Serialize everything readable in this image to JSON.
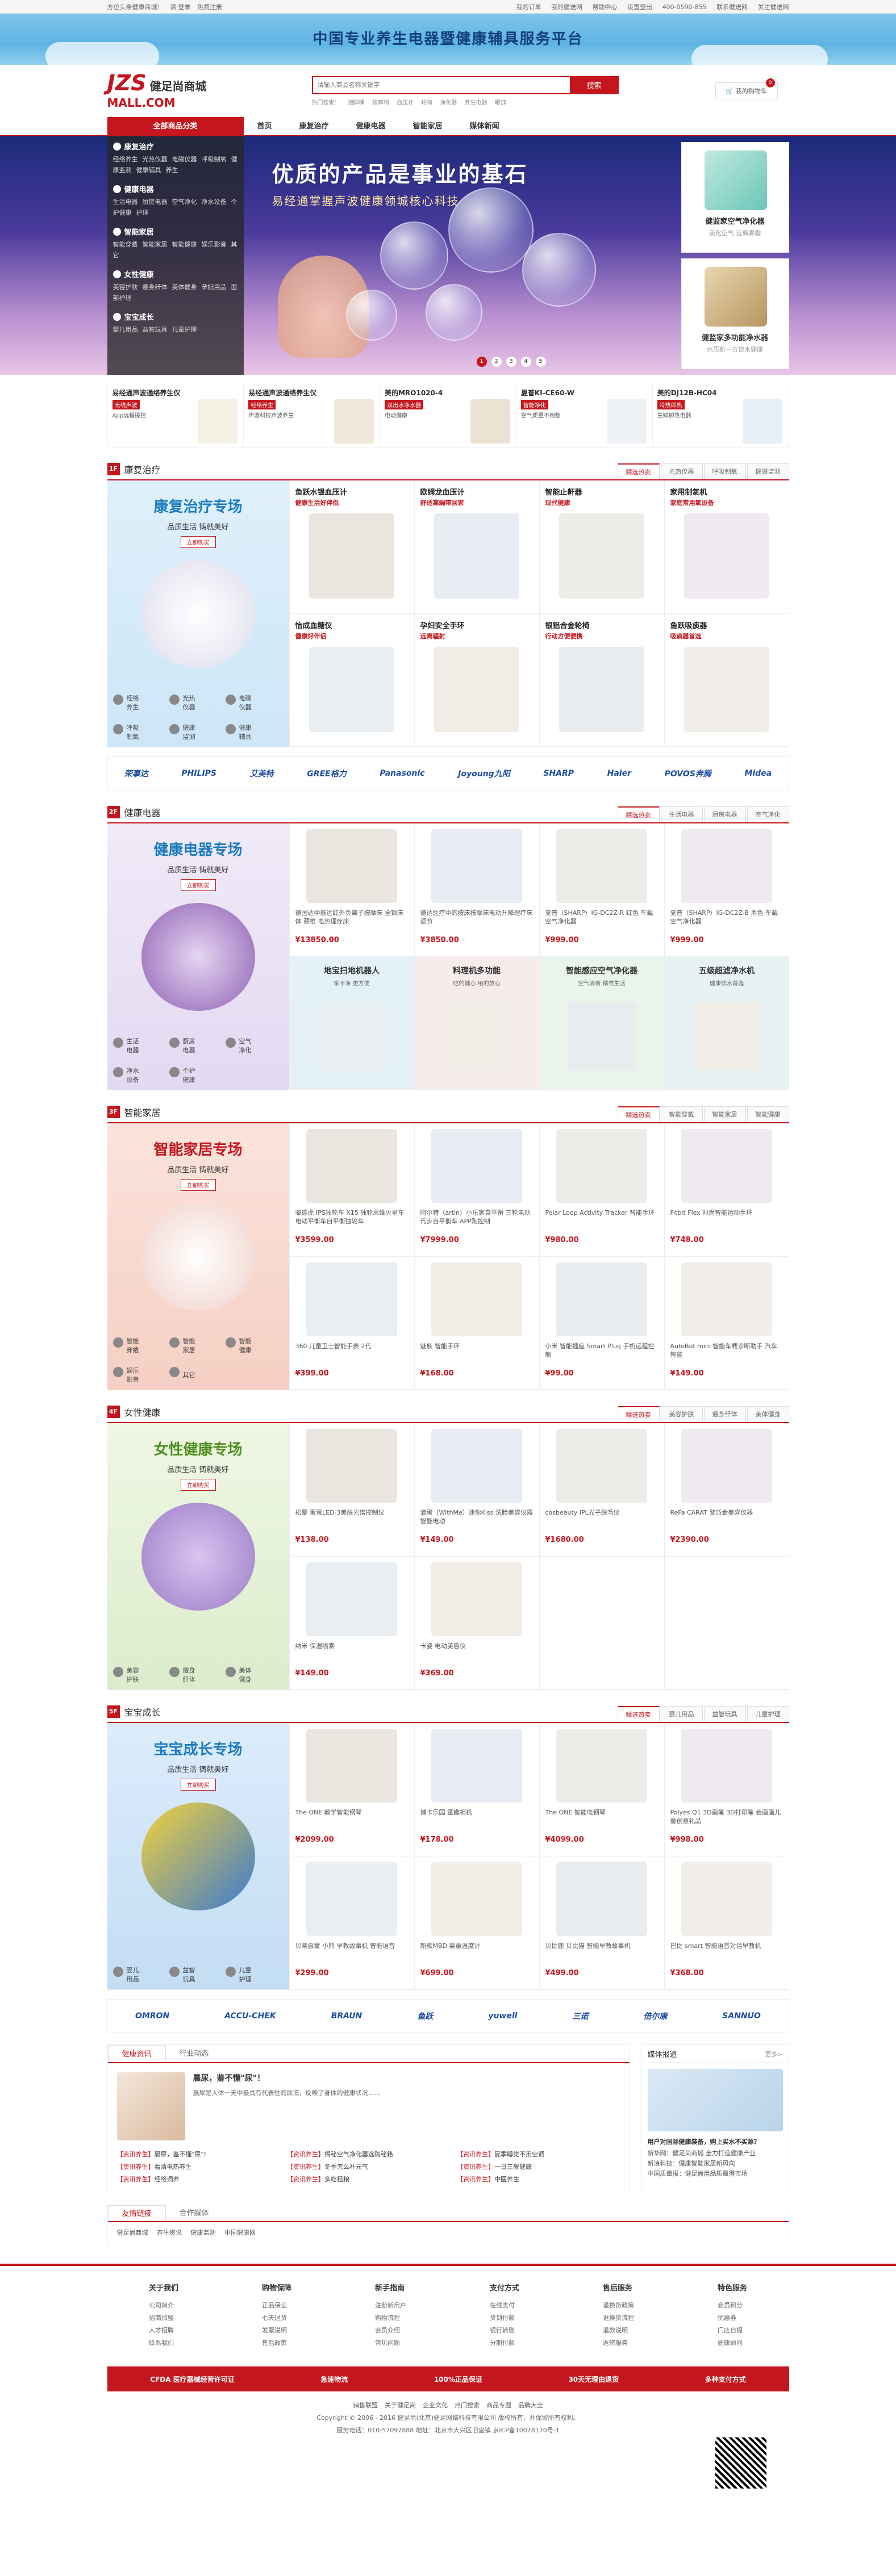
{
  "topbar": {
    "left": [
      "方位头条健康商城！",
      "请 登录",
      "免费注册"
    ],
    "right": [
      "我的订单",
      "我的健送网",
      "帮助中心",
      "设置登出",
      "400-0590-855",
      "联系健送网",
      "关注健送网"
    ]
  },
  "banner_strip": {
    "text": "中国专业养生电器暨健康辅具服务平台"
  },
  "logo": {
    "line1": "JZS",
    "line1b": "健足尚商城",
    "line2": "MALL.COM"
  },
  "search": {
    "placeholder": "请输入商品名称关键字",
    "button": "搜索",
    "hot": [
      "热门搜索：",
      "泡脚桶",
      "按摩椅",
      "血压计",
      "轮椅",
      "净化器",
      "养生电器",
      "眼部"
    ]
  },
  "cart": {
    "label": "我的购物车",
    "count": "0"
  },
  "nav": {
    "all": "全部商品分类",
    "items": [
      "首页",
      "康复治疗",
      "健康电器",
      "智能家居",
      "媒体新闻"
    ]
  },
  "categories": [
    {
      "title": "康复治疗",
      "subs": [
        "经络养生",
        "光热仪器",
        "电磁仪器",
        "呼吸制氧",
        "健康监测",
        "健康辅具",
        "养生"
      ]
    },
    {
      "title": "健康电器",
      "subs": [
        "生活电器",
        "厨房电器",
        "空气净化",
        "净水设备",
        "个护健康",
        "护理"
      ]
    },
    {
      "title": "智能家居",
      "subs": [
        "智能穿戴",
        "智能家居",
        "智能健康",
        "娱乐影音",
        "其它"
      ]
    },
    {
      "title": "女性健康",
      "subs": [
        "美容护肤",
        "瘦身纤体",
        "美体健身",
        "孕妇用品",
        "面部护理"
      ]
    },
    {
      "title": "宝宝成长",
      "subs": [
        "婴儿用品",
        "益智玩具",
        "儿童护理"
      ]
    }
  ],
  "hero": {
    "title": "优质的产品是事业的基石",
    "subtitle": "易经通掌握声波健康领城核心科技",
    "dots": [
      "1",
      "2",
      "3",
      "4",
      "5"
    ],
    "cards": [
      {
        "t1": "健监家空气净化器",
        "t2": "美化空气 远离雾霾"
      },
      {
        "t1": "健监家多功能净水器",
        "t2": "水质新一方饮水健康"
      }
    ]
  },
  "promos": [
    {
      "title": "易经通声波通络养生仪",
      "badge": "无线声波",
      "desc": "App远程操控"
    },
    {
      "title": "易经通声波通络养生仪",
      "badge": "经络养生",
      "desc": "声波科技声波养生"
    },
    {
      "title": "美的MRO1020-4",
      "badge": "双出水净水器",
      "desc": "电动健康"
    },
    {
      "title": "夏普KI-CE60-W",
      "badge": "智能净化",
      "desc": "空气质量不用愁"
    },
    {
      "title": "美的DJ12B-HC04",
      "badge": "冷热即热",
      "desc": "生鲜即热电器"
    }
  ],
  "sections": [
    {
      "icon": "1F",
      "title": "康复治疗",
      "tabs": [
        "精选热卖",
        "光热仪器",
        "呼吸制氧",
        "健康监测"
      ],
      "left": {
        "title": "康复治疗专场",
        "sub": "品质生活 铸就美好",
        "btn": "立即购买",
        "links": [
          "经络养生",
          "光热仪器",
          "电磁仪器",
          "呼吸制氧",
          "健康监测",
          "健康辅具"
        ]
      },
      "cells": [
        {
          "kind": "tag",
          "t": "鱼跃水银血压计",
          "d": "健康生活好伴侣"
        },
        {
          "kind": "tag",
          "t": "欧姆龙血压计",
          "d": "舒适高端带回家"
        },
        {
          "kind": "tag",
          "t": "智能止鼾器",
          "d": "现代健康"
        },
        {
          "kind": "tag",
          "t": "家用制氧机",
          "d": "家庭常用氧设备"
        },
        {
          "kind": "tag",
          "t": "怡成血糖仪",
          "d": "健康好伴侣"
        },
        {
          "kind": "tag",
          "t": "孕妇安全手环",
          "d": "远离辐射"
        },
        {
          "kind": "tag",
          "t": "银铝合金轮椅",
          "d": "行动方便便携"
        },
        {
          "kind": "tag",
          "t": "鱼跃吸痰器",
          "d": "吸痰器首选"
        }
      ]
    },
    {
      "icon": "2F",
      "title": "健康电器",
      "tabs": [
        "精选热卖",
        "生活电器",
        "厨房电器",
        "空气净化"
      ],
      "left": {
        "title": "健康电器专场",
        "sub": "品质生活 铸就美好",
        "btn": "立即购买",
        "links": [
          "生活电器",
          "厨房电器",
          "空气净化",
          "净水设备",
          "个护健康"
        ]
      },
      "cells": [
        {
          "kind": "prod",
          "n": "德国达中能远红外负离子按摩床 全钢床体 颈椎 电热理疗床",
          "p": "¥13850.00"
        },
        {
          "kind": "prod",
          "n": "德达医疗中的按床按摩床电动升降理疗床调节",
          "p": "¥3850.00"
        },
        {
          "kind": "prod",
          "n": "夏普（SHARP）IG-DC2Z-R 红色 车载空气净化器",
          "p": "¥999.00"
        },
        {
          "kind": "prod",
          "n": "夏普（SHARP）IG-DC2Z-B 黑色 车载空气净化器",
          "p": "¥999.00"
        },
        {
          "kind": "banner",
          "t": "地宝扫地机器人",
          "s": "家干净 更方便"
        },
        {
          "kind": "banner",
          "t": "料理机多功能",
          "s": "吃的健心 用的放心"
        },
        {
          "kind": "banner",
          "t": "智能感应空气净化器",
          "s": "空气清新 精致生活"
        },
        {
          "kind": "banner",
          "t": "五级超滤净水机",
          "s": "健康饮水首选"
        }
      ]
    },
    {
      "icon": "3F",
      "title": "智能家居",
      "tabs": [
        "精选热卖",
        "智能穿戴",
        "智能家居",
        "智能健康"
      ],
      "left": {
        "title": "智能家居专场",
        "sub": "品质生活 铸就美好",
        "btn": "立即购买",
        "links": [
          "智能穿戴",
          "智能家居",
          "智能健康",
          "娱乐影音",
          "其它"
        ]
      },
      "cells": [
        {
          "kind": "prod",
          "n": "骑德虎 IPS独轮车 X15 独轮思维火星车 电动平衡车自平衡独轮车",
          "p": "¥3599.00"
        },
        {
          "kind": "prod",
          "n": "阿尔特（artin）小乐家自平衡 三轮电动代步自平衡车 APP跑控制",
          "p": "¥7999.00"
        },
        {
          "kind": "prod",
          "n": "Polar Loop Activity Tracker 智能手环",
          "p": "¥980.00"
        },
        {
          "kind": "prod",
          "n": "Fitbit Flex 时尚智能运动手环",
          "p": "¥748.00"
        },
        {
          "kind": "prod",
          "n": "360 儿童卫士智能手表 2代",
          "p": "¥399.00"
        },
        {
          "kind": "prod",
          "n": "魅族 智能手环",
          "p": "¥168.00"
        },
        {
          "kind": "prod",
          "n": "小米 智能插座 Smart Plug 手机远程控制",
          "p": "¥99.00"
        },
        {
          "kind": "prod",
          "n": "AutoBot mini 智能车载诊断助手 汽车智能",
          "p": "¥149.00"
        }
      ]
    },
    {
      "icon": "4F",
      "title": "女性健康",
      "tabs": [
        "精选热卖",
        "美容护肤",
        "瘦身纤体",
        "美体健身"
      ],
      "left": {
        "title": "女性健康专场",
        "sub": "品质生活 铸就美好",
        "btn": "立即购买",
        "links": [
          "美容护肤",
          "瘦身纤体",
          "美体健身"
        ]
      },
      "cells": [
        {
          "kind": "prod",
          "n": "松厦 蛋蛋LED-3美肤光谱控制仪",
          "p": "¥138.00"
        },
        {
          "kind": "prod",
          "n": "滴蛋（WithMe）迷你Kiss 洗脸美容仪器 智能电动",
          "p": "¥149.00"
        },
        {
          "kind": "prod",
          "n": "cosbeauty IPL光子脱毛仪",
          "p": "¥1680.00"
        },
        {
          "kind": "prod",
          "n": "ReFa CARAT 黎派金美容仪器",
          "p": "¥2390.00"
        },
        {
          "kind": "prod",
          "n": "纳米 保湿喷雾",
          "p": "¥149.00"
        },
        {
          "kind": "prod",
          "n": "卡姿 电动美容仪",
          "p": "¥369.00"
        },
        {
          "kind": "empty"
        },
        {
          "kind": "empty"
        }
      ]
    },
    {
      "icon": "5F",
      "title": "宝宝成长",
      "tabs": [
        "精选热卖",
        "婴儿用品",
        "益智玩具",
        "儿童护理"
      ],
      "left": {
        "title": "宝宝成长专场",
        "sub": "品质生活 铸就美好",
        "btn": "立即购买",
        "links": [
          "婴儿用品",
          "益智玩具",
          "儿童护理"
        ]
      },
      "cells": [
        {
          "kind": "prod",
          "n": "The ONE 教学智能钢琴",
          "p": "¥2099.00"
        },
        {
          "kind": "prod",
          "n": "博卡乐园 童趣相机",
          "p": "¥178.00"
        },
        {
          "kind": "prod",
          "n": "The ONE 智能电钢琴",
          "p": "¥4099.00"
        },
        {
          "kind": "prod",
          "n": "Polyes Q1 3D画笔 3D打印笔 会画画儿童创意礼品",
          "p": "¥998.00"
        },
        {
          "kind": "prod",
          "n": "贝蒂启蒙 小熊 早教故事机 智能语音",
          "p": "¥299.00"
        },
        {
          "kind": "prod",
          "n": "新款MBD 婴童温度计",
          "p": "¥699.00"
        },
        {
          "kind": "prod",
          "n": "贝比鹿 贝比猫 智能早教故事机",
          "p": "¥499.00"
        },
        {
          "kind": "prod",
          "n": "巴比 smart 智能语音对话早教机",
          "p": "¥368.00"
        }
      ]
    }
  ],
  "brands1": [
    "荣事达",
    "PHILIPS",
    "艾美特",
    "GREE格力",
    "Panasonic",
    "Joyoung九阳",
    "SHARP",
    "Haier",
    "POVOS奔腾",
    "Midea"
  ],
  "brands2": [
    "OMRON",
    "ACCU-CHEK",
    "BRAUN",
    "鱼跃",
    "",
    "yuwell",
    "三诺",
    "倍尔康",
    "SANNUO"
  ],
  "news": {
    "tabs": [
      "健康资讯",
      "行业动态"
    ],
    "title": "晨尿，鉴不懂\"尿\"！",
    "text": "晨尿是人体一天中最具有代表性的尿液，反映了身体的健康状况……",
    "list": [
      [
        "【资讯养生】",
        "晨尿，鉴不懂\"尿\"!"
      ],
      [
        "【资讯养生】",
        "揭秘空气净化器选购秘籍"
      ],
      [
        "【资讯养生】",
        "夏季睡觉不用空调"
      ],
      [
        "【资讯养生】",
        "看清电热养生"
      ],
      [
        "【资讯养生】",
        "冬季怎么补元气"
      ],
      [
        "【资讯养生】",
        "一日三餐健康"
      ],
      [
        "【资讯养生】",
        "经络调养"
      ],
      [
        "【资讯养生】",
        "多吃粗粮"
      ],
      [
        "【资讯养生】",
        "中医养生"
      ]
    ]
  },
  "media": {
    "title": "媒体报道",
    "more": "更多>",
    "head": "用户对国际健康装备，购上买水不买源？",
    "lines": [
      "新华网：健足尚商城 全力打造健康产业",
      "新浪科技：健康智能家居新风向",
      "中国质量报：健足尚用品质赢得市场"
    ]
  },
  "links": {
    "tabs": [
      "友情链接",
      "合作媒体"
    ],
    "items": [
      "健足尚商城",
      "养生资讯",
      "健康监测",
      "中国健康网"
    ]
  },
  "footer": {
    "cols": [
      {
        "h": "关于我们",
        "l": [
          "公司简介",
          "招商加盟",
          "人才招聘",
          "联系我们"
        ]
      },
      {
        "h": "购物保障",
        "l": [
          "正品保证",
          "七天退货",
          "发票说明",
          "售后政策"
        ]
      },
      {
        "h": "新手指南",
        "l": [
          "注册新用户",
          "购物流程",
          "会员介绍",
          "常见问题"
        ]
      },
      {
        "h": "支付方式",
        "l": [
          "在线支付",
          "货到付款",
          "银行转账",
          "分期付款"
        ]
      },
      {
        "h": "售后服务",
        "l": [
          "退换货政策",
          "退换货流程",
          "退款说明",
          "返修服务"
        ]
      },
      {
        "h": "特色服务",
        "l": [
          "会员积分",
          "优惠券",
          "门店自提",
          "健康顾问"
        ]
      }
    ],
    "guarantees": [
      "CFDA 医疗器械经营许可证",
      "急速物流",
      "100%正品保证",
      "30天无理由退货",
      "多种支付方式"
    ],
    "bottom_links": [
      "销售联盟",
      "关于健足尚",
      "企业文化",
      "热门搜索",
      "商品专题",
      "品牌大全"
    ],
    "copyright": "Copyright © 2006 - 2016 健足尚(北京)健足网络科技有限公司 版权所有，并保留所有权利。",
    "contact": "服务电话：010-57097888 地址：北京市大兴区旧宫镇 京ICP备10028170号-1"
  }
}
